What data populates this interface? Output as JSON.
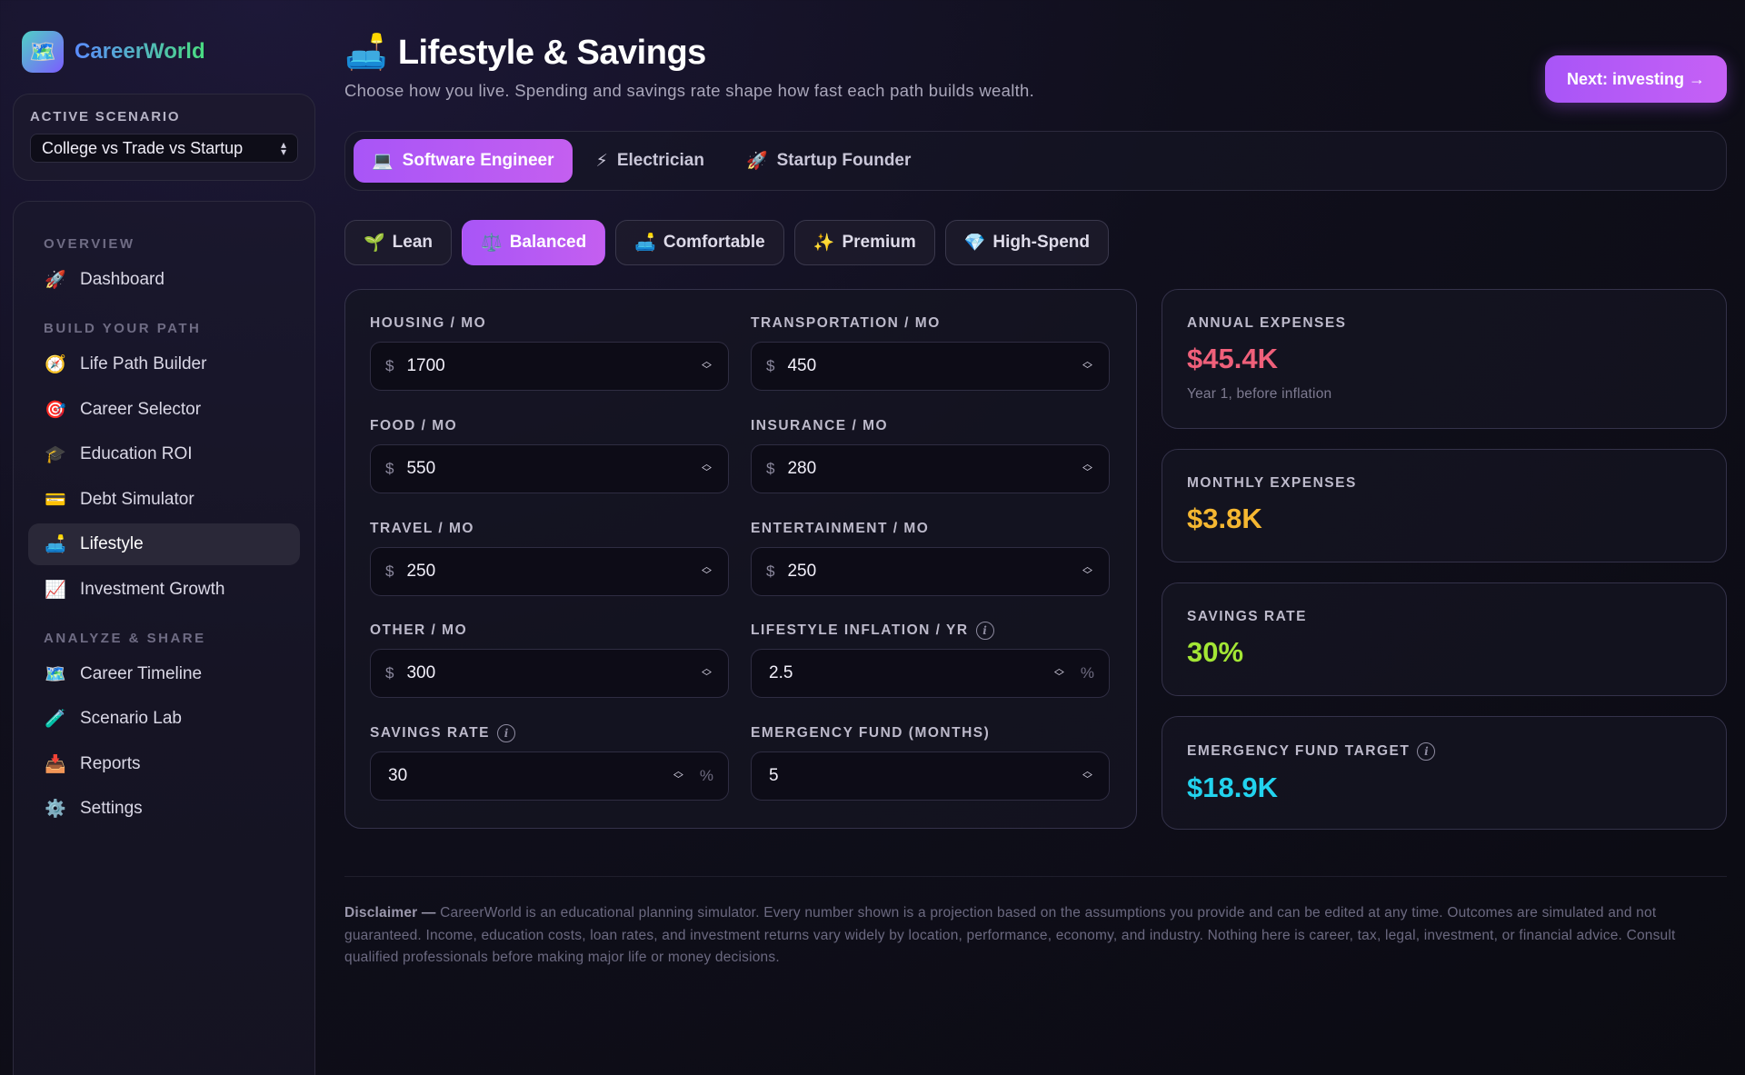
{
  "brand": {
    "name": "CareerWorld",
    "logo_icon": "🗺️"
  },
  "scenario": {
    "label": "ACTIVE SCENARIO",
    "selected": "College vs Trade vs Startup"
  },
  "nav": {
    "sections": [
      {
        "title": "OVERVIEW",
        "items": [
          {
            "icon": "🚀",
            "label": "Dashboard",
            "active": false
          }
        ]
      },
      {
        "title": "BUILD YOUR PATH",
        "items": [
          {
            "icon": "🧭",
            "label": "Life Path Builder",
            "active": false
          },
          {
            "icon": "🎯",
            "label": "Career Selector",
            "active": false
          },
          {
            "icon": "🎓",
            "label": "Education ROI",
            "active": false
          },
          {
            "icon": "💳",
            "label": "Debt Simulator",
            "active": false
          },
          {
            "icon": "🛋️",
            "label": "Lifestyle",
            "active": true
          },
          {
            "icon": "📈",
            "label": "Investment Growth",
            "active": false
          }
        ]
      },
      {
        "title": "ANALYZE & SHARE",
        "items": [
          {
            "icon": "🗺️",
            "label": "Career Timeline",
            "active": false
          },
          {
            "icon": "🧪",
            "label": "Scenario Lab",
            "active": false
          },
          {
            "icon": "📥",
            "label": "Reports",
            "active": false
          },
          {
            "icon": "⚙️",
            "label": "Settings",
            "active": false
          }
        ]
      }
    ]
  },
  "header": {
    "icon": "🛋️",
    "title": "Lifestyle & Savings",
    "subtitle": "Choose how you live. Spending and savings rate shape how fast each path builds wealth.",
    "next_button": "Next: investing →"
  },
  "career_tabs": [
    {
      "icon": "💻",
      "label": "Software Engineer",
      "active": true
    },
    {
      "icon": "⚡",
      "label": "Electrician",
      "active": false
    },
    {
      "icon": "🚀",
      "label": "Startup Founder",
      "active": false
    }
  ],
  "presets": [
    {
      "icon": "🌱",
      "label": "Lean",
      "active": false
    },
    {
      "icon": "⚖️",
      "label": "Balanced",
      "active": true
    },
    {
      "icon": "🛋️",
      "label": "Comfortable",
      "active": false
    },
    {
      "icon": "✨",
      "label": "Premium",
      "active": false
    },
    {
      "icon": "💎",
      "label": "High-Spend",
      "active": false
    }
  ],
  "fields": [
    {
      "label": "HOUSING / MO",
      "prefix": "$",
      "value": "1700",
      "suffix": "",
      "info": false
    },
    {
      "label": "TRANSPORTATION / MO",
      "prefix": "$",
      "value": "450",
      "suffix": "",
      "info": false
    },
    {
      "label": "FOOD / MO",
      "prefix": "$",
      "value": "550",
      "suffix": "",
      "info": false
    },
    {
      "label": "INSURANCE / MO",
      "prefix": "$",
      "value": "280",
      "suffix": "",
      "info": false
    },
    {
      "label": "TRAVEL / MO",
      "prefix": "$",
      "value": "250",
      "suffix": "",
      "info": false
    },
    {
      "label": "ENTERTAINMENT / MO",
      "prefix": "$",
      "value": "250",
      "suffix": "",
      "info": false
    },
    {
      "label": "OTHER / MO",
      "prefix": "$",
      "value": "300",
      "suffix": "",
      "info": false
    },
    {
      "label": "LIFESTYLE INFLATION / YR",
      "prefix": "",
      "value": "2.5",
      "suffix": "%",
      "info": true
    },
    {
      "label": "SAVINGS RATE",
      "prefix": "",
      "value": "30",
      "suffix": "%",
      "info": true
    },
    {
      "label": "EMERGENCY FUND (MONTHS)",
      "prefix": "",
      "value": "5",
      "suffix": "",
      "info": false
    }
  ],
  "stats": [
    {
      "label": "ANNUAL EXPENSES",
      "value": "$45.4K",
      "note": "Year 1, before inflation",
      "color": "#f0607a",
      "info": false
    },
    {
      "label": "MONTHLY EXPENSES",
      "value": "$3.8K",
      "note": "",
      "color": "#f5b731",
      "info": false
    },
    {
      "label": "SAVINGS RATE",
      "value": "30%",
      "note": "",
      "color": "#a3e635",
      "info": false
    },
    {
      "label": "EMERGENCY FUND TARGET",
      "value": "$18.9K",
      "note": "",
      "color": "#22d3ee",
      "info": true
    }
  ],
  "disclaimer": {
    "lead": "Disclaimer —",
    "text": " CareerWorld is an educational planning simulator. Every number shown is a projection based on the assumptions you provide and can be edited at any time. Outcomes are simulated and not guaranteed. Income, education costs, loan rates, and investment returns vary widely by location, performance, economy, and industry. Nothing here is career, tax, legal, investment, or financial advice. Consult qualified professionals before making major life or money decisions."
  }
}
